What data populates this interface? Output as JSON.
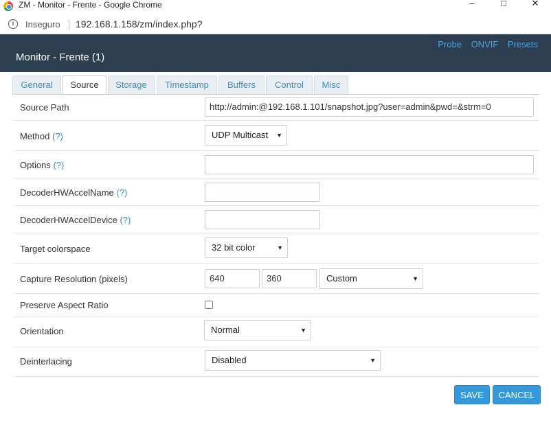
{
  "window": {
    "title": "ZM - Monitor - Frente - Google Chrome",
    "minimize": "–",
    "maximize": "□",
    "close": "✕"
  },
  "address": {
    "security": "Inseguro",
    "url": "192.168.1.158/zm/index.php?"
  },
  "modal": {
    "title": "Monitor - Frente (1)",
    "links": [
      "Probe",
      "ONVIF",
      "Presets"
    ]
  },
  "tabs": [
    "General",
    "Source",
    "Storage",
    "Timestamp",
    "Buffers",
    "Control",
    "Misc"
  ],
  "active_tab": "Source",
  "fields": {
    "source_path": {
      "label": "Source Path",
      "value": "http://admin:@192.168.1.101/snapshot.jpg?user=admin&pwd=&strm=0"
    },
    "method": {
      "label": "Method",
      "help": "(?)",
      "value": "UDP Multicast"
    },
    "options": {
      "label": "Options",
      "help": "(?)",
      "value": ""
    },
    "decoder_hw_accel_name": {
      "label": "DecoderHWAccelName",
      "help": "(?)",
      "value": ""
    },
    "decoder_hw_accel_device": {
      "label": "DecoderHWAccelDevice",
      "help": "(?)",
      "value": ""
    },
    "target_colorspace": {
      "label": "Target colorspace",
      "value": "32 bit color"
    },
    "capture_resolution": {
      "label": "Capture Resolution (pixels)",
      "width": "640",
      "height": "360",
      "preset": "Custom"
    },
    "preserve_aspect_ratio": {
      "label": "Preserve Aspect Ratio",
      "checked": false
    },
    "orientation": {
      "label": "Orientation",
      "value": "Normal"
    },
    "deinterlacing": {
      "label": "Deinterlacing",
      "value": "Disabled"
    }
  },
  "buttons": {
    "save": "SAVE",
    "cancel": "CANCEL"
  },
  "colors": {
    "header_bg": "#2c3e50",
    "accent": "#3498db",
    "link": "#4aa3df"
  }
}
